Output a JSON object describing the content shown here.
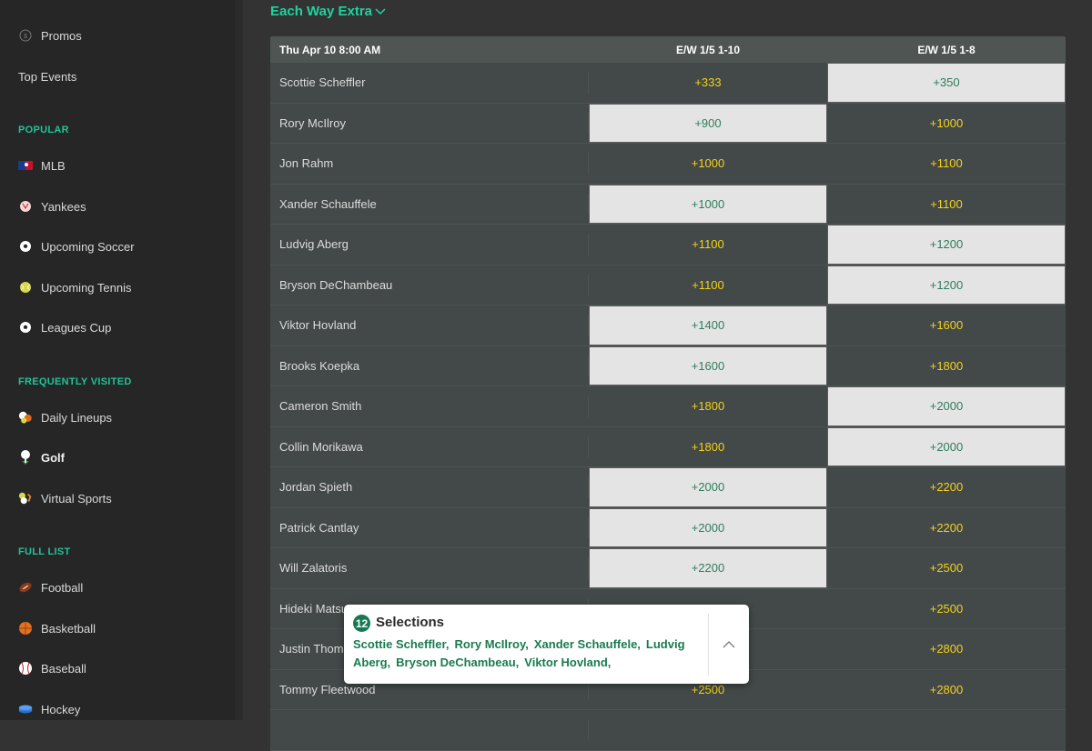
{
  "sidebar": {
    "top_items": [
      {
        "label": "Promos",
        "icon": "dollar-circle-icon"
      },
      {
        "label": "Top Events",
        "icon": ""
      }
    ],
    "sections": [
      {
        "heading": "POPULAR",
        "items": [
          {
            "label": "MLB",
            "icon": "mlb-logo-icon"
          },
          {
            "label": "Yankees",
            "icon": "yankees-logo-icon"
          },
          {
            "label": "Upcoming Soccer",
            "icon": "soccer-ball-icon"
          },
          {
            "label": "Upcoming Tennis",
            "icon": "tennis-ball-icon"
          },
          {
            "label": "Leagues Cup",
            "icon": "soccer-ball-icon"
          }
        ]
      },
      {
        "heading": "FREQUENTLY VISITED",
        "items": [
          {
            "label": "Daily Lineups",
            "icon": "multi-sport-icon"
          },
          {
            "label": "Golf",
            "icon": "golf-tee-icon",
            "active": true
          },
          {
            "label": "Virtual Sports",
            "icon": "virtual-sports-icon"
          }
        ]
      },
      {
        "heading": "FULL LIST",
        "items": [
          {
            "label": "Football",
            "icon": "football-icon"
          },
          {
            "label": "Basketball",
            "icon": "basketball-icon"
          },
          {
            "label": "Baseball",
            "icon": "baseball-icon"
          },
          {
            "label": "Hockey",
            "icon": "hockey-puck-icon"
          }
        ]
      }
    ]
  },
  "market": {
    "title": "Each Way Extra",
    "date_header": "Thu Apr 10 8:00 AM",
    "columns": [
      "E/W 1/5 1-10",
      "E/W 1/5 1-8"
    ],
    "rows": [
      {
        "player": "Scottie Scheffler",
        "odds": [
          "+333",
          "+350"
        ],
        "selected": [
          false,
          true
        ]
      },
      {
        "player": "Rory McIlroy",
        "odds": [
          "+900",
          "+1000"
        ],
        "selected": [
          true,
          false
        ]
      },
      {
        "player": "Jon Rahm",
        "odds": [
          "+1000",
          "+1100"
        ],
        "selected": [
          false,
          false
        ]
      },
      {
        "player": "Xander Schauffele",
        "odds": [
          "+1000",
          "+1100"
        ],
        "selected": [
          true,
          false
        ]
      },
      {
        "player": "Ludvig Aberg",
        "odds": [
          "+1100",
          "+1200"
        ],
        "selected": [
          false,
          true
        ]
      },
      {
        "player": "Bryson DeChambeau",
        "odds": [
          "+1100",
          "+1200"
        ],
        "selected": [
          false,
          true
        ]
      },
      {
        "player": "Viktor Hovland",
        "odds": [
          "+1400",
          "+1600"
        ],
        "selected": [
          true,
          false
        ]
      },
      {
        "player": "Brooks Koepka",
        "odds": [
          "+1600",
          "+1800"
        ],
        "selected": [
          true,
          false
        ]
      },
      {
        "player": "Cameron Smith",
        "odds": [
          "+1800",
          "+2000"
        ],
        "selected": [
          false,
          true
        ]
      },
      {
        "player": "Collin Morikawa",
        "odds": [
          "+1800",
          "+2000"
        ],
        "selected": [
          false,
          true
        ]
      },
      {
        "player": "Jordan Spieth",
        "odds": [
          "+2000",
          "+2200"
        ],
        "selected": [
          true,
          false
        ]
      },
      {
        "player": "Patrick Cantlay",
        "odds": [
          "+2000",
          "+2200"
        ],
        "selected": [
          true,
          false
        ]
      },
      {
        "player": "Will Zalatoris",
        "odds": [
          "+2200",
          "+2500"
        ],
        "selected": [
          true,
          false
        ]
      },
      {
        "player": "Hideki Matsuyama",
        "odds": [
          "",
          "+2500"
        ],
        "selected": [
          false,
          false
        ]
      },
      {
        "player": "Justin Thomas",
        "odds": [
          "",
          "+2800"
        ],
        "selected": [
          false,
          false
        ]
      },
      {
        "player": "Tommy Fleetwood",
        "odds": [
          "+2500",
          "+2800"
        ],
        "selected": [
          false,
          false
        ]
      },
      {
        "player": "",
        "odds": [
          "",
          ""
        ],
        "selected": [
          false,
          false
        ]
      }
    ]
  },
  "betslip": {
    "count": "12",
    "title": "Selections",
    "names": [
      "Scottie Scheffler,",
      "Rory McIlroy,",
      "Xander Schauffele,",
      "Ludvig Aberg,",
      "Bryson DeChambeau,",
      "Viktor Hovland,"
    ],
    "toggle_icon": "chevron-up-icon"
  },
  "colors": {
    "accent": "#1fd39f",
    "odds_default": "#f2d21b",
    "odds_selected_text": "#2f7d5d",
    "odds_selected_bg": "#e4e4e4",
    "badge": "#157a52"
  }
}
